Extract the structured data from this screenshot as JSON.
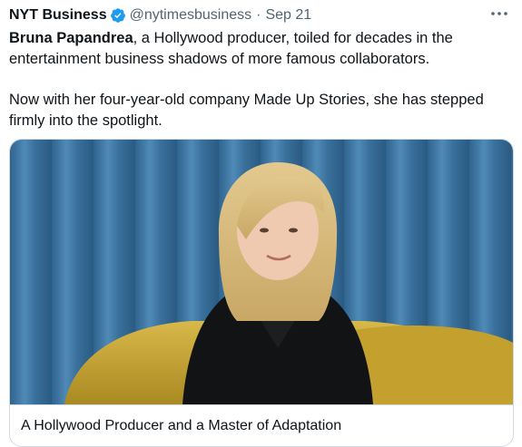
{
  "tweet": {
    "author_name": "NYT Business",
    "handle": "@nytimesbusiness",
    "separator": "·",
    "date": "Sep 21",
    "text_bold": "Bruna Papandrea",
    "text_rest": ", a Hollywood producer, toiled for decades in the entertainment business shadows of more famous collaborators.",
    "text_para2": "Now with her four-year-old company Made Up Stories, she has stepped firmly into the spotlight."
  },
  "card": {
    "caption": "A Hollywood Producer and a Master of Adaptation"
  },
  "colors": {
    "verified_blue": "#1d9bf0",
    "secondary_text": "#536471",
    "curtain_blue": "#3f7aa6",
    "chair_yellow": "#c9a635"
  },
  "icons": {
    "verified": "verified-badge-icon",
    "more": "more-dots-icon"
  }
}
